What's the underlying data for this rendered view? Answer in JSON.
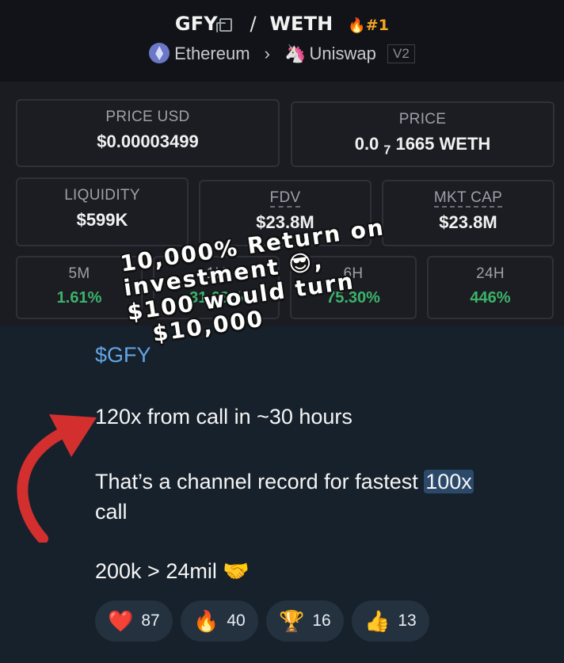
{
  "header": {
    "base": "GFY",
    "quote": "WETH",
    "rank": "#1",
    "chain": "Ethereum",
    "dex": "Uniswap",
    "version": "V2"
  },
  "stats": {
    "price_usd_label": "PRICE USD",
    "price_usd": "$0.00003499",
    "price_label": "PRICE",
    "price_native_prefix": "0.0",
    "price_native_zeros": "7",
    "price_native_rest": "1665 WETH",
    "liquidity_label": "LIQUIDITY",
    "liquidity": "$599K",
    "fdv_label": "FDV",
    "fdv": "$23.8M",
    "mktcap_label": "MKT CAP",
    "mktcap": "$23.8M",
    "changes": [
      {
        "label": "5M",
        "value": "1.61%"
      },
      {
        "label": "1H",
        "value": "31.03%"
      },
      {
        "label": "6H",
        "value": "75.30%"
      },
      {
        "label": "24H",
        "value": "446%"
      }
    ]
  },
  "overlay": {
    "line1": "10,000% Return on",
    "line2": "investment 😎,",
    "line3": "$100 would turn",
    "line4": "$10,000"
  },
  "message": {
    "tag": "$GFY",
    "line1": "120x from call in  ~30 hours",
    "line2_pre": "That’s a channel record for fastest ",
    "line2_hl": "100x",
    "line2_post": "call",
    "line3": "200k > 24mil 🤝"
  },
  "reactions": [
    {
      "emoji": "❤️",
      "count": "87"
    },
    {
      "emoji": "🔥",
      "count": "40"
    },
    {
      "emoji": "🏆",
      "count": "16"
    },
    {
      "emoji": "👍",
      "count": "13"
    }
  ],
  "colors": {
    "positive": "#3bb46a",
    "accent": "#f5a623",
    "link": "#62a6e6",
    "arrow": "#d32f2f"
  }
}
